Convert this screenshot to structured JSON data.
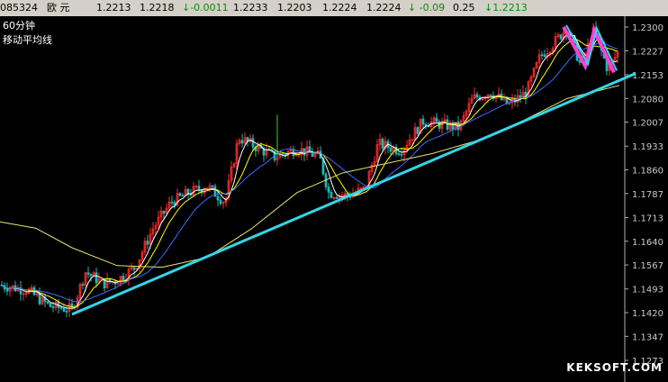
{
  "quote": {
    "code": "085324",
    "name": "欧  元",
    "open": "1.2213",
    "high": "1.2218",
    "change": "↓-0.0011",
    "low": "1.2233",
    "f5": "1.2203",
    "f6": "1.2224",
    "f7": "1.2224",
    "change_pct": "↓ -0.09",
    "f9": "0.25",
    "last": "↓1.2213"
  },
  "legend": {
    "interval": "60分钟",
    "indicator": "移动平均线"
  },
  "watermark": "KEKSOFT.COM",
  "chart_data": {
    "type": "line",
    "yaxis_ticks": [
      "1.2300",
      "1.2227",
      "1.2153",
      "1.2080",
      "1.2007",
      "1.1933",
      "1.1860",
      "1.1787",
      "1.1713",
      "1.1640",
      "1.1567",
      "1.1493",
      "1.1420",
      "1.1347",
      "1.1273"
    ],
    "ylim": [
      1.1273,
      1.234
    ],
    "colors": {
      "candle_up": "#ff2a2a",
      "candle_dn": "#1fb8b8",
      "ma_fast": "#ffffff",
      "ma_mid": "#ffff00",
      "ma_slow": "#e6e66a",
      "ma_blue": "#3d6cff",
      "trendline": "#32d6ea",
      "zigzag_pink": "#ff3fd8",
      "zigzag_cyan": "#32d6ea"
    }
  }
}
